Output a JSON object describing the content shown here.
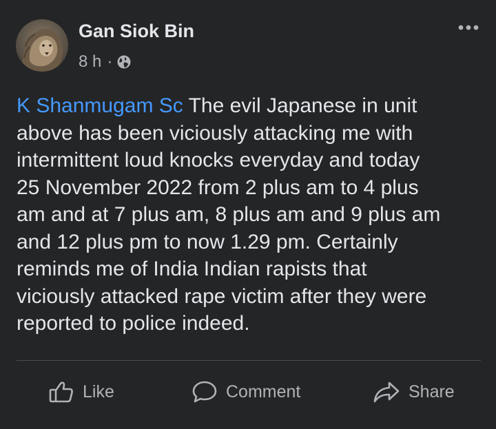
{
  "post": {
    "author": "Gan Siok Bin",
    "timestamp": "8 h",
    "separator": "·",
    "audience_icon": "globe-icon",
    "more_icon": "more-options-icon",
    "mention": "K Shanmugam Sc",
    "lines": [
      " The evil Japanese in unit",
      "above has been viciously attacking me with",
      "intermittent loud knocks everyday and today",
      "25 November 2022 from 2 plus am to 4 plus",
      "am and at 7 plus am, 8 plus am and 9 plus am",
      "and 12 plus pm to now 1.29 pm. Certainly",
      "reminds me of India Indian rapists that",
      "viciously attacked rape victim after they were",
      "reported to police indeed."
    ]
  },
  "actions": {
    "like_label": "Like",
    "comment_label": "Comment",
    "share_label": "Share"
  },
  "colors": {
    "background": "#242526",
    "text": "#e4e6eb",
    "secondary": "#b0b3b8",
    "mention": "#4599ff"
  }
}
